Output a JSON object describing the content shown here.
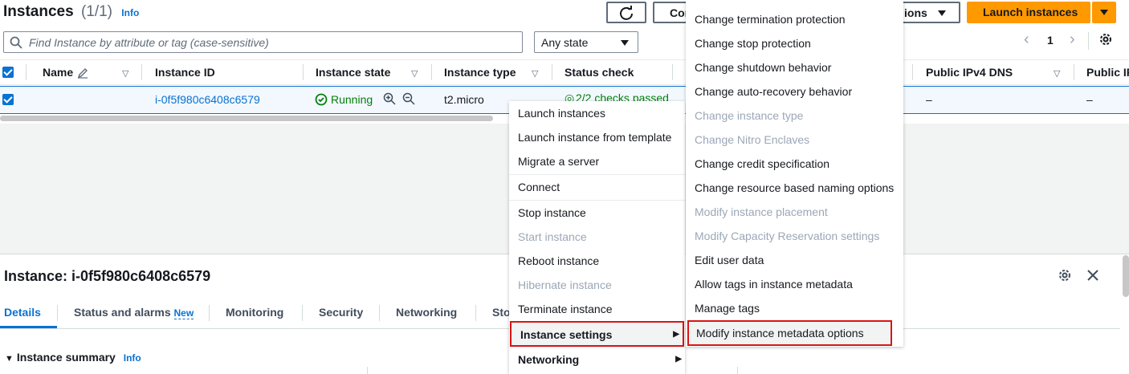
{
  "header": {
    "title": "Instances",
    "count": "(1/1)",
    "info": "Info",
    "connect_label": "Con",
    "actions_label": "ions",
    "launch_label": "Launch instances"
  },
  "filter": {
    "placeholder": "Find Instance by attribute or tag (case-sensitive)",
    "state_select": "Any state"
  },
  "pagination": {
    "page": "1"
  },
  "table": {
    "columns": [
      "Name",
      "Instance ID",
      "Instance state",
      "Instance type",
      "Status check",
      "Public IPv4 DNS",
      "Public IP"
    ],
    "row": {
      "instance_id": "i-0f5f980c6408c6579",
      "state": "Running",
      "type": "t2.micro",
      "status": "2/2 checks passed",
      "dns": "–",
      "ip": "–"
    }
  },
  "detail": {
    "title": "Instance: i-0f5f980c6408c6579",
    "tabs": [
      "Details",
      "Status and alarms",
      "Monitoring",
      "Security",
      "Networking",
      "Sto"
    ],
    "new_badge": "New",
    "summary": "Instance summary",
    "summary_info": "Info"
  },
  "actions_menu": [
    {
      "label": "Launch instances",
      "disabled": false
    },
    {
      "label": "Launch instance from template",
      "disabled": false
    },
    {
      "label": "Migrate a server",
      "disabled": false
    },
    {
      "label": "Connect",
      "disabled": false
    },
    {
      "label": "Stop instance",
      "disabled": false
    },
    {
      "label": "Start instance",
      "disabled": true
    },
    {
      "label": "Reboot instance",
      "disabled": false
    },
    {
      "label": "Hibernate instance",
      "disabled": true
    },
    {
      "label": "Terminate instance",
      "disabled": false
    },
    {
      "label": "Instance settings",
      "disabled": false
    },
    {
      "label": "Networking",
      "disabled": false
    }
  ],
  "settings_submenu": [
    {
      "label": "Change termination protection",
      "disabled": false
    },
    {
      "label": "Change stop protection",
      "disabled": false
    },
    {
      "label": "Change shutdown behavior",
      "disabled": false
    },
    {
      "label": "Change auto-recovery behavior",
      "disabled": false
    },
    {
      "label": "Change instance type",
      "disabled": true
    },
    {
      "label": "Change Nitro Enclaves",
      "disabled": true
    },
    {
      "label": "Change credit specification",
      "disabled": false
    },
    {
      "label": "Change resource based naming options",
      "disabled": false
    },
    {
      "label": "Modify instance placement",
      "disabled": true
    },
    {
      "label": "Modify Capacity Reservation settings",
      "disabled": true
    },
    {
      "label": "Edit user data",
      "disabled": false
    },
    {
      "label": "Allow tags in instance metadata",
      "disabled": false
    },
    {
      "label": "Manage tags",
      "disabled": false
    },
    {
      "label": "Modify instance metadata options",
      "disabled": false
    }
  ],
  "colors": {
    "primary": "#ff9900",
    "link": "#0972d3",
    "success": "#037f0c",
    "highlight": "#d91515"
  }
}
